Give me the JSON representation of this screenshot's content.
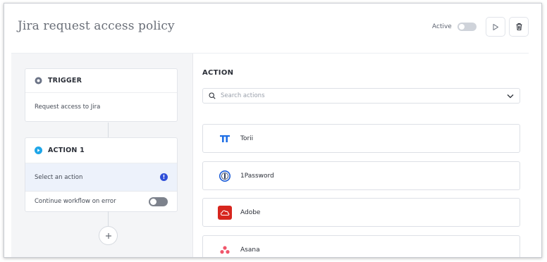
{
  "header": {
    "title": "Jira request access policy",
    "active_label": "Active",
    "active_on": false
  },
  "workflow": {
    "trigger": {
      "label": "TRIGGER",
      "value": "Request access to Jira"
    },
    "action1": {
      "label": "ACTION 1",
      "select_text": "Select an action",
      "error_icon": "exclamation-icon",
      "continue_label": "Continue workflow on error",
      "continue_on": false
    },
    "add_icon": "plus-icon"
  },
  "action_panel": {
    "title": "ACTION",
    "search_placeholder": "Search actions",
    "items": [
      {
        "name": "Torii",
        "icon": "torii-logo",
        "color": "#1f6fe5"
      },
      {
        "name": "1Password",
        "icon": "1password-logo",
        "color": "#1a5bd6"
      },
      {
        "name": "Adobe",
        "icon": "adobe-cloud-logo",
        "color": "#d7261e"
      },
      {
        "name": "Asana",
        "icon": "asana-logo",
        "color": "#f0566b"
      }
    ]
  }
}
